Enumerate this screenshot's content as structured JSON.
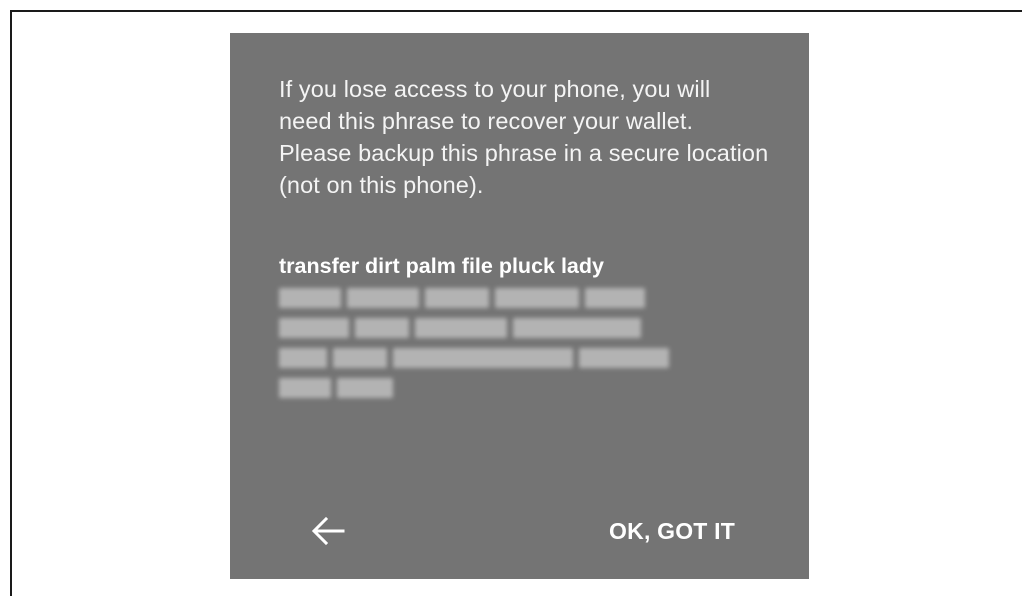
{
  "dialog": {
    "message": "If you lose access to your phone, you will need this phrase to recover your wallet. Please backup this phrase in a secure location (not on this phone).",
    "phrase_visible": "transfer dirt palm file pluck lady",
    "ok_label": "OK, GOT IT",
    "back_icon": "arrow-left-icon"
  },
  "colors": {
    "dialog_background": "#747474",
    "text": "#ffffff",
    "blurred_text": "#bfbfbf"
  }
}
